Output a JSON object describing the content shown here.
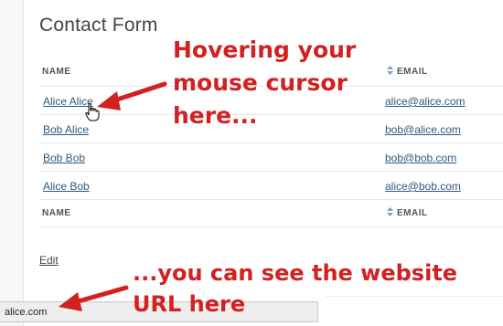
{
  "page": {
    "title": "Contact Form"
  },
  "table": {
    "headers": {
      "name": "NAME",
      "email": "EMAIL"
    },
    "footer": {
      "name": "NAME",
      "email": "EMAIL"
    },
    "rows": [
      {
        "name": "Alice Alice",
        "email": "alice@alice.com"
      },
      {
        "name": "Bob Alice",
        "email": "bob@alice.com"
      },
      {
        "name": "Bob Bob",
        "email": "bob@bob.com"
      },
      {
        "name": "Alice Bob",
        "email": "alice@bob.com"
      }
    ]
  },
  "actions": {
    "edit": "Edit"
  },
  "status_bar": {
    "url": "alice.com"
  },
  "annotations": {
    "top": [
      "Hovering your",
      "mouse cursor",
      "here..."
    ],
    "bottom": [
      "...you can see the website",
      "URL here"
    ]
  },
  "colors": {
    "annotation": "#d32020",
    "link": "#2e5a80"
  },
  "icons": {
    "sort": "sort-icon",
    "cursor": "hand-pointer-icon"
  }
}
